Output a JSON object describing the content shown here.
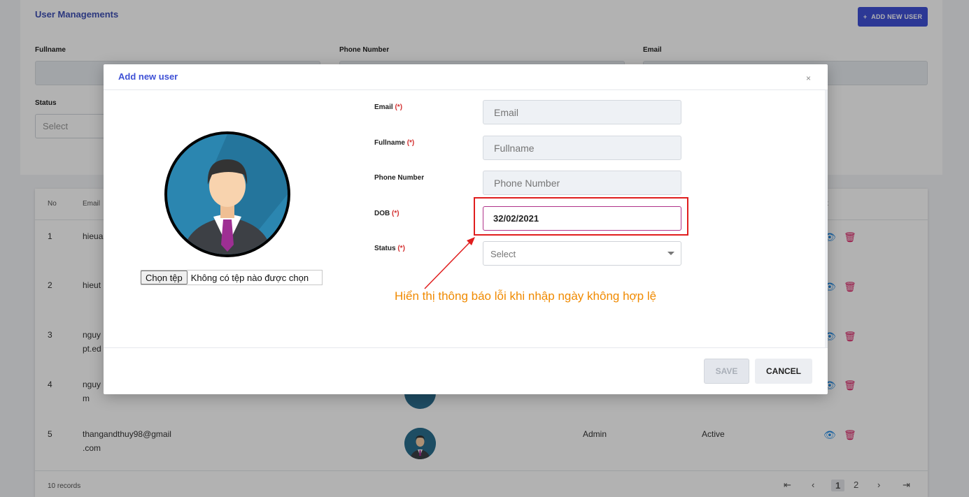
{
  "page": {
    "title": "User Managements",
    "add_button_label": "ADD NEW USER",
    "filters": {
      "fullname_label": "Fullname",
      "phone_label": "Phone Number",
      "email_label": "Email",
      "status_label": "Status",
      "status_placeholder": "Select"
    },
    "table": {
      "headers": [
        "No",
        "Email",
        "ct"
      ],
      "rows": [
        {
          "no": "1",
          "email": "hieua"
        },
        {
          "no": "2",
          "email": "hieut"
        },
        {
          "no": "3",
          "email": "nguy",
          "email_line2": "pt.ed"
        },
        {
          "no": "4",
          "email": "nguy",
          "email_line2": "m"
        },
        {
          "no": "5",
          "email": "thangandthuy98@gmail",
          "email_line2": ".com",
          "role": "Admin",
          "status": "Active"
        }
      ],
      "records": "10 records",
      "pages": [
        "1",
        "2"
      ]
    }
  },
  "modal": {
    "title": "Add new user",
    "close": "×",
    "file_button": "Chọn tệp",
    "file_status": "Không có tệp nào được chọn",
    "fields": {
      "email": {
        "label": "Email",
        "required": "(*)",
        "placeholder": "Email"
      },
      "fullname": {
        "label": "Fullname",
        "required": "(*)",
        "placeholder": "Fullname"
      },
      "phone": {
        "label": "Phone Number",
        "placeholder": "Phone Number"
      },
      "dob": {
        "label": "DOB",
        "required": "(*)",
        "value": "32/02/2021"
      },
      "status": {
        "label": "Status",
        "required": "(*)",
        "placeholder": "Select"
      }
    },
    "annotation": "Hiển thị thông báo lỗi khi nhập ngày không hợp lệ",
    "save_label": "SAVE",
    "cancel_label": "CANCEL"
  },
  "colors": {
    "accent": "#3f51d6",
    "required": "#d32f2f",
    "annotation": "#f08a00",
    "highlight": "#e01e1e"
  }
}
